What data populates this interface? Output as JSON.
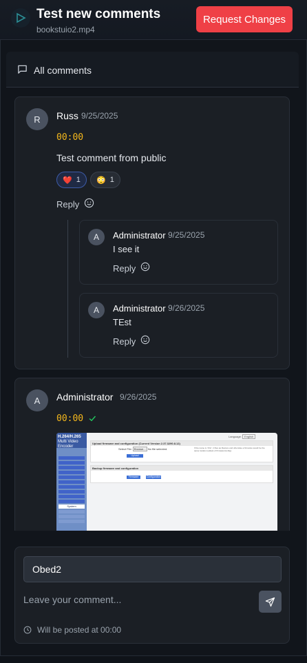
{
  "header": {
    "title": "Test new comments",
    "filename": "bookstuio2.mp4",
    "request_changes_label": "Request Changes",
    "request_changes_color": "#ef4046"
  },
  "comments_panel": {
    "label": "All comments",
    "icon": "message-square-icon"
  },
  "comments": [
    {
      "avatar": "R",
      "author": "Russ",
      "date": "9/25/2025",
      "timestamp": "00:00",
      "text": "Test comment from public",
      "reactions": [
        {
          "emoji": "❤️",
          "count": "1",
          "active": true
        },
        {
          "emoji": "😳",
          "count": "1",
          "active": false
        }
      ],
      "reply_label": "Reply",
      "replies": [
        {
          "avatar": "A",
          "author": "Administrator",
          "date": "9/25/2025",
          "text": "I see it",
          "reply_label": "Reply"
        },
        {
          "avatar": "A",
          "author": "Administrator",
          "date": "9/26/2025",
          "text": "TEst",
          "reply_label": "Reply"
        }
      ]
    },
    {
      "avatar": "A",
      "author": "Administrator",
      "date": "9/26/2025",
      "timestamp": "00:00",
      "resolved_icon": "check-icon",
      "attachment": {
        "brand_line1": "H.264/H.265",
        "brand_line2": "Multi Video Encoder",
        "section1_title": "Upload firmware and configuration (Current Version 2.37.3290.8.12)",
        "select_file_label": "Select File:",
        "browse_label": "Browse...",
        "no_file_label": "No file selected.",
        "upload_note": "If the name is 'zFin', it files as Restore and otherwise a firmware would be the same location (oldest of firmware/config).",
        "upload_label": "Upload",
        "section2_title": "Backup firmware and configuration",
        "firmware_label": "Firmware",
        "configuration_label": "Configuration",
        "language_label": "Language:",
        "language_value": "English",
        "system_label": "System"
      }
    }
  ],
  "composer": {
    "name_value": "Obed2",
    "comment_placeholder": "Leave your comment...",
    "posted_at": "Will be posted at 00:00",
    "send_icon": "send-icon",
    "clock_icon": "clock-icon"
  },
  "colors": {
    "background": "#0f1319",
    "card": "#1b1f25",
    "timestamp": "#f5b81c",
    "resolved": "#22c55e"
  }
}
